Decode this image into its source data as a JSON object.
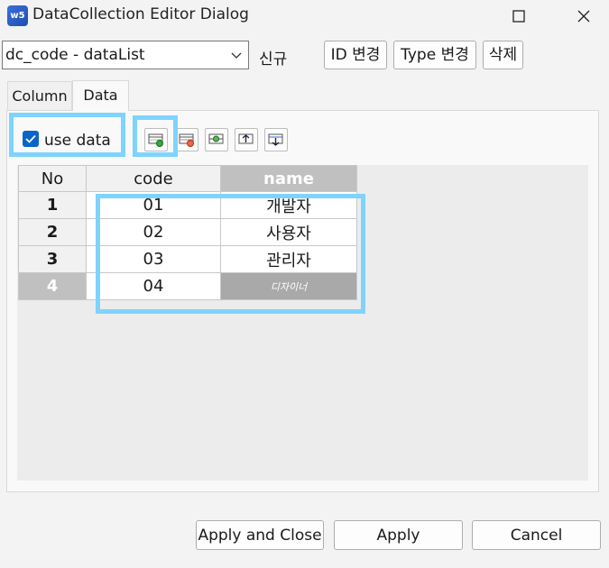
{
  "window": {
    "title": "DataCollection Editor Dialog",
    "icon_text": "w5"
  },
  "top": {
    "combo_value": "dc_code - dataList",
    "new_label": "신규",
    "id_change": "ID 변경",
    "type_change": "Type 변경",
    "delete": "삭제"
  },
  "tabs": [
    "Column",
    "Data"
  ],
  "toolbar": {
    "use_data_label": "use data",
    "use_data_checked": true,
    "icons": [
      "add-row-icon",
      "delete-row-icon",
      "insert-row-icon",
      "move-up-icon",
      "move-down-icon"
    ]
  },
  "grid": {
    "headers": [
      "No",
      "code",
      "name"
    ],
    "rows": [
      {
        "no": "1",
        "code": "01",
        "name": "개발자"
      },
      {
        "no": "2",
        "code": "02",
        "name": "사용자"
      },
      {
        "no": "3",
        "code": "03",
        "name": "관리자"
      },
      {
        "no": "4",
        "code": "04",
        "name": "디자이너"
      }
    ]
  },
  "buttons": {
    "apply_close": "Apply and Close",
    "apply": "Apply",
    "cancel": "Cancel"
  },
  "colors": {
    "highlight": "#7ed3ff",
    "checkbox": "#0a64c8",
    "selected_header": "#c0c0c0"
  }
}
